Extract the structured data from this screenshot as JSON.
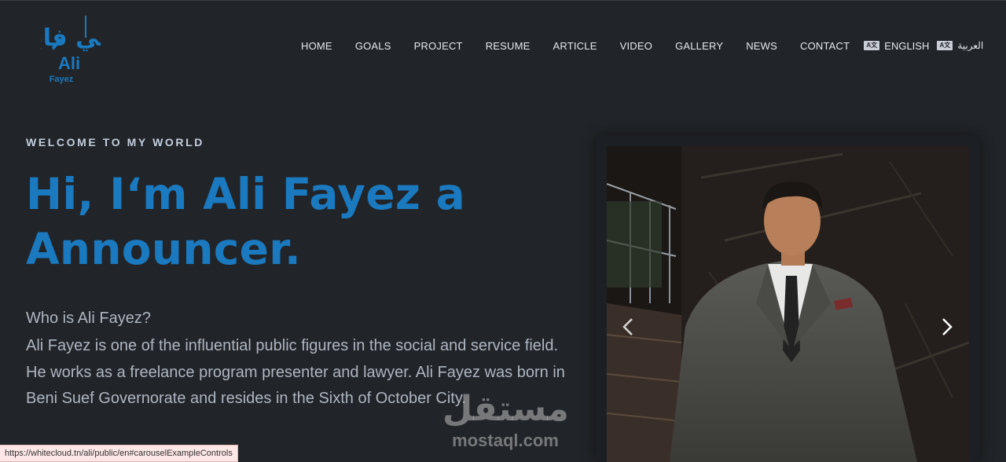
{
  "brand": {
    "logo_arabic": "علي فايز",
    "logo_latin_1": "Ali",
    "logo_latin_2": "Fayez",
    "color": "#1a79bf"
  },
  "nav": {
    "items": [
      {
        "label": "HOME"
      },
      {
        "label": "GOALS"
      },
      {
        "label": "PROJECT"
      },
      {
        "label": "RESUME"
      },
      {
        "label": "ARTICLE"
      },
      {
        "label": "VIDEO"
      },
      {
        "label": "GALLERY"
      },
      {
        "label": "NEWS"
      },
      {
        "label": "CONTACT"
      }
    ],
    "lang_en": "ENGLISH",
    "lang_ar": "العربية",
    "lang_icon": "language-icon"
  },
  "hero": {
    "welcome": "WELCOME TO MY WORLD",
    "headline_line1": "Hi, I‘m Ali Fayez a",
    "headline_line2": "Announcer.",
    "question": "Who is Ali Fayez?",
    "bio": "Ali Fayez is one of the influential public figures in the social and service field. He works as a freelance program presenter and lawyer. Ali Fayez was born in Beni Suef Governorate and resides in the Sixth of October City."
  },
  "carousel": {
    "prev_icon": "chevron-left-icon",
    "next_icon": "chevron-right-icon"
  },
  "status": {
    "url": "https://whitecloud.tn/ali/public/en#carouselExampleControls"
  },
  "watermark": {
    "arabic": "مستقل",
    "latin": "mostaql.com"
  }
}
